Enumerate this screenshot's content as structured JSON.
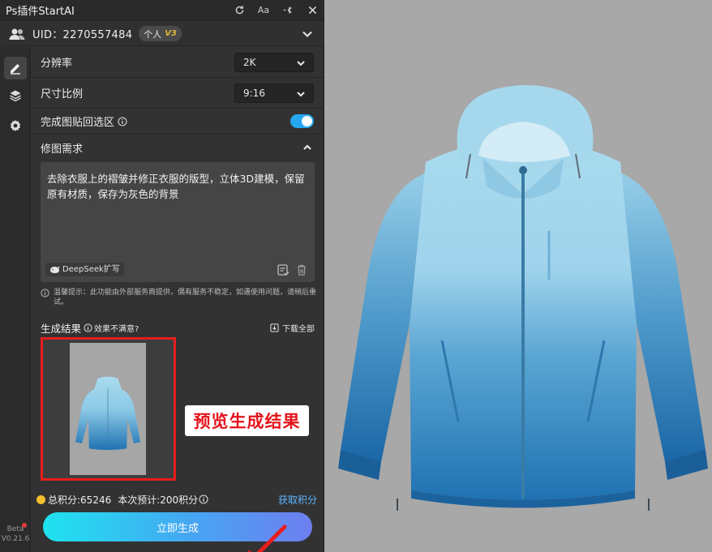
{
  "app": {
    "title": "Ps插件StartAI",
    "font_size_label": "Aa"
  },
  "user": {
    "uid_text": "UID：2270557484",
    "badge_label": "个人",
    "level": "V3"
  },
  "settings": {
    "resolution": {
      "label": "分辨率",
      "value": "2K"
    },
    "aspect_ratio": {
      "label": "尺寸比例",
      "value": "9:16"
    },
    "paste_back": {
      "label": "完成图贴回选区",
      "enabled": true
    }
  },
  "edit_request": {
    "label": "修图需求",
    "text": "去除衣服上的褶皱并修正衣服的版型，立体3D建模，保留原有材质，保存为灰色的背景",
    "deepseek_label": "DeepSeek扩写"
  },
  "tip": {
    "text": "温馨提示：此功能由外部服务商提供，偶有服务不稳定，如遇使用问题，请稍后重试。"
  },
  "results": {
    "title": "生成结果",
    "unsatisfied": "效果不满意?",
    "download_all": "下载全部"
  },
  "callout": {
    "text": "预览生成结果"
  },
  "points": {
    "total": "总积分:65246",
    "estimate": "本次预计:200积分",
    "earn_link": "获取积分"
  },
  "generate_button": {
    "label": "立即生成"
  },
  "version": {
    "channel": "Beta",
    "number": "V0.21.6"
  },
  "colors": {
    "accent_toggle": "#25a8f0",
    "highlight_border": "#e81d1d",
    "callout_text": "#e4141b",
    "link": "#5db4ff",
    "jacket_top": "#a9dbee",
    "jacket_bottom": "#1f72b2"
  }
}
